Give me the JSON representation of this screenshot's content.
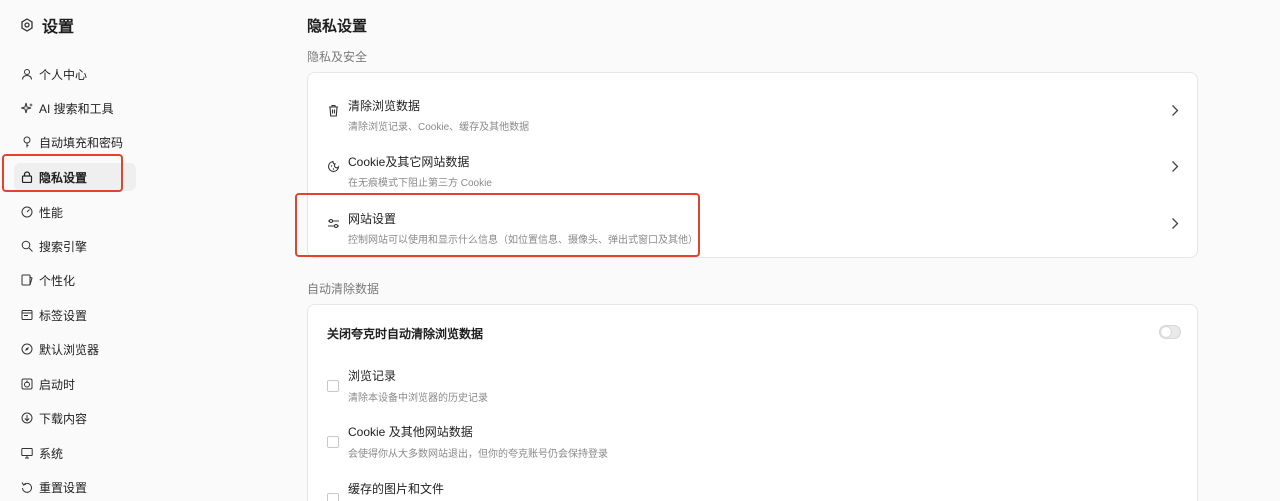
{
  "sidebar": {
    "title": "设置",
    "items": [
      {
        "label": "个人中心",
        "icon": "user-icon"
      },
      {
        "label": "AI 搜索和工具",
        "icon": "sparkle-icon"
      },
      {
        "label": "自动填充和密码",
        "icon": "key-icon"
      },
      {
        "label": "隐私设置",
        "icon": "lock-icon",
        "active": true
      },
      {
        "label": "性能",
        "icon": "gauge-icon"
      },
      {
        "label": "搜索引擎",
        "icon": "search-icon"
      },
      {
        "label": "个性化",
        "icon": "palette-icon"
      },
      {
        "label": "标签设置",
        "icon": "tab-icon"
      },
      {
        "label": "默认浏览器",
        "icon": "compass-icon"
      },
      {
        "label": "启动时",
        "icon": "power-icon"
      },
      {
        "label": "下载内容",
        "icon": "download-icon"
      },
      {
        "label": "系统",
        "icon": "monitor-icon"
      },
      {
        "label": "重置设置",
        "icon": "reset-icon"
      }
    ]
  },
  "main": {
    "title": "隐私设置",
    "privacy_section": {
      "label": "隐私及安全",
      "rows": [
        {
          "title": "清除浏览数据",
          "subtitle": "清除浏览记录、Cookie、缓存及其他数据",
          "icon": "trash-icon"
        },
        {
          "title": "Cookie及其它网站数据",
          "subtitle": "在无痕模式下阻止第三方 Cookie",
          "icon": "cookie-icon"
        },
        {
          "title": "网站设置",
          "subtitle": "控制网站可以使用和显示什么信息（如位置信息、摄像头、弹出式窗口及其他）",
          "icon": "sliders-icon"
        }
      ]
    },
    "autoclear_section": {
      "label": "自动清除数据",
      "toggle_label": "关闭夸克时自动清除浏览数据",
      "toggle_on": false,
      "options": [
        {
          "title": "浏览记录",
          "subtitle": "清除本设备中浏览器的历史记录",
          "checked": false
        },
        {
          "title": "Cookie 及其他网站数据",
          "subtitle": "会使得你从大多数网站退出，但你的夸克账号仍会保持登录",
          "checked": false
        },
        {
          "title": "缓存的图片和文件",
          "subtitle": "",
          "checked": false
        }
      ]
    }
  },
  "colors": {
    "highlight": "#e0452b",
    "active_bg": "#efefef"
  }
}
